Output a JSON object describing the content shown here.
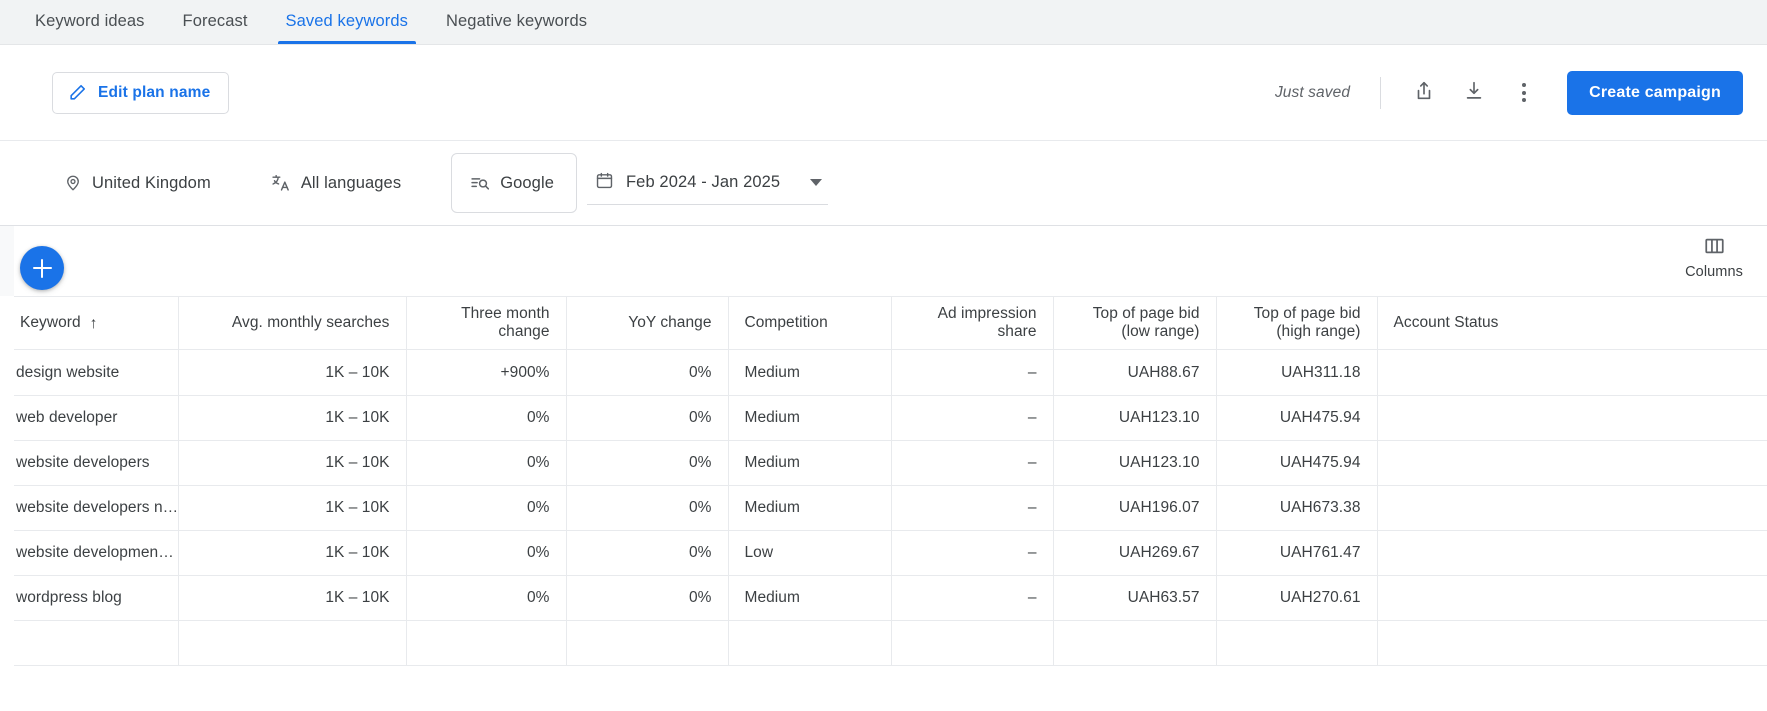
{
  "tabs": [
    {
      "label": "Keyword ideas",
      "active": false
    },
    {
      "label": "Forecast",
      "active": false
    },
    {
      "label": "Saved keywords",
      "active": true
    },
    {
      "label": "Negative keywords",
      "active": false
    }
  ],
  "toolbar": {
    "edit_plan_label": "Edit plan name",
    "edit_plan_icon": "pencil-icon",
    "status_text": "Just saved",
    "share_icon": "share-upload-icon",
    "download_icon": "download-icon",
    "more_icon": "more-vertical-icon",
    "create_campaign_label": "Create campaign"
  },
  "filters": {
    "location": {
      "label": "United Kingdom",
      "icon": "location-pin-icon"
    },
    "language": {
      "label": "All languages",
      "icon": "translate-icon"
    },
    "network": {
      "label": "Google",
      "icon": "search-network-icon"
    },
    "date_range": {
      "label": "Feb 2024 - Jan 2025",
      "icon": "calendar-icon",
      "caret": "chevron-down-icon"
    }
  },
  "table_tools": {
    "add_label": "+",
    "add_icon": "plus-icon",
    "columns_label": "Columns",
    "columns_icon": "columns-icon"
  },
  "table": {
    "sort_column": "Keyword",
    "sort_direction": "ascending",
    "sort_glyph": "↑",
    "columns": [
      {
        "label": "Keyword",
        "align": "left",
        "sorted": true
      },
      {
        "label": "Avg. monthly searches",
        "align": "right",
        "sorted": false
      },
      {
        "label": "Three month change",
        "align": "right",
        "sorted": false
      },
      {
        "label": "YoY change",
        "align": "right",
        "sorted": false
      },
      {
        "label": "Competition",
        "align": "left",
        "sorted": false
      },
      {
        "label": "Ad impression share",
        "align": "right",
        "sorted": false
      },
      {
        "label": "Top of page bid (low range)",
        "align": "right",
        "sorted": false
      },
      {
        "label": "Top of page bid (high range)",
        "align": "right",
        "sorted": false
      },
      {
        "label": "Account Status",
        "align": "left",
        "sorted": false
      }
    ],
    "rows": [
      {
        "keyword": "design website",
        "avg_monthly_searches": "1K – 10K",
        "three_month_change": "+900%",
        "yoy_change": "0%",
        "competition": "Medium",
        "ad_impression_share": "–",
        "bid_low": "UAH88.67",
        "bid_high": "UAH311.18",
        "account_status": ""
      },
      {
        "keyword": "web developer",
        "avg_monthly_searches": "1K – 10K",
        "three_month_change": "0%",
        "yoy_change": "0%",
        "competition": "Medium",
        "ad_impression_share": "–",
        "bid_low": "UAH123.10",
        "bid_high": "UAH475.94",
        "account_status": ""
      },
      {
        "keyword": "website developers",
        "avg_monthly_searches": "1K – 10K",
        "three_month_change": "0%",
        "yoy_change": "0%",
        "competition": "Medium",
        "ad_impression_share": "–",
        "bid_low": "UAH123.10",
        "bid_high": "UAH475.94",
        "account_status": ""
      },
      {
        "keyword": "website developers n…",
        "avg_monthly_searches": "1K – 10K",
        "three_month_change": "0%",
        "yoy_change": "0%",
        "competition": "Medium",
        "ad_impression_share": "–",
        "bid_low": "UAH196.07",
        "bid_high": "UAH673.38",
        "account_status": ""
      },
      {
        "keyword": "website developmen…",
        "avg_monthly_searches": "1K – 10K",
        "three_month_change": "0%",
        "yoy_change": "0%",
        "competition": "Low",
        "ad_impression_share": "–",
        "bid_low": "UAH269.67",
        "bid_high": "UAH761.47",
        "account_status": ""
      },
      {
        "keyword": "wordpress blog",
        "avg_monthly_searches": "1K – 10K",
        "three_month_change": "0%",
        "yoy_change": "0%",
        "competition": "Medium",
        "ad_impression_share": "–",
        "bid_low": "UAH63.57",
        "bid_high": "UAH270.61",
        "account_status": ""
      },
      {
        "keyword": "",
        "avg_monthly_searches": "",
        "three_month_change": "",
        "yoy_change": "",
        "competition": "",
        "ad_impression_share": "",
        "bid_low": "",
        "bid_high": "",
        "account_status": ""
      }
    ]
  },
  "colors": {
    "accent": "#1a73e8",
    "tabbar_bg": "#f1f3f4",
    "text": "#3c4043",
    "muted": "#5f6368",
    "border": "#e8eaed"
  }
}
